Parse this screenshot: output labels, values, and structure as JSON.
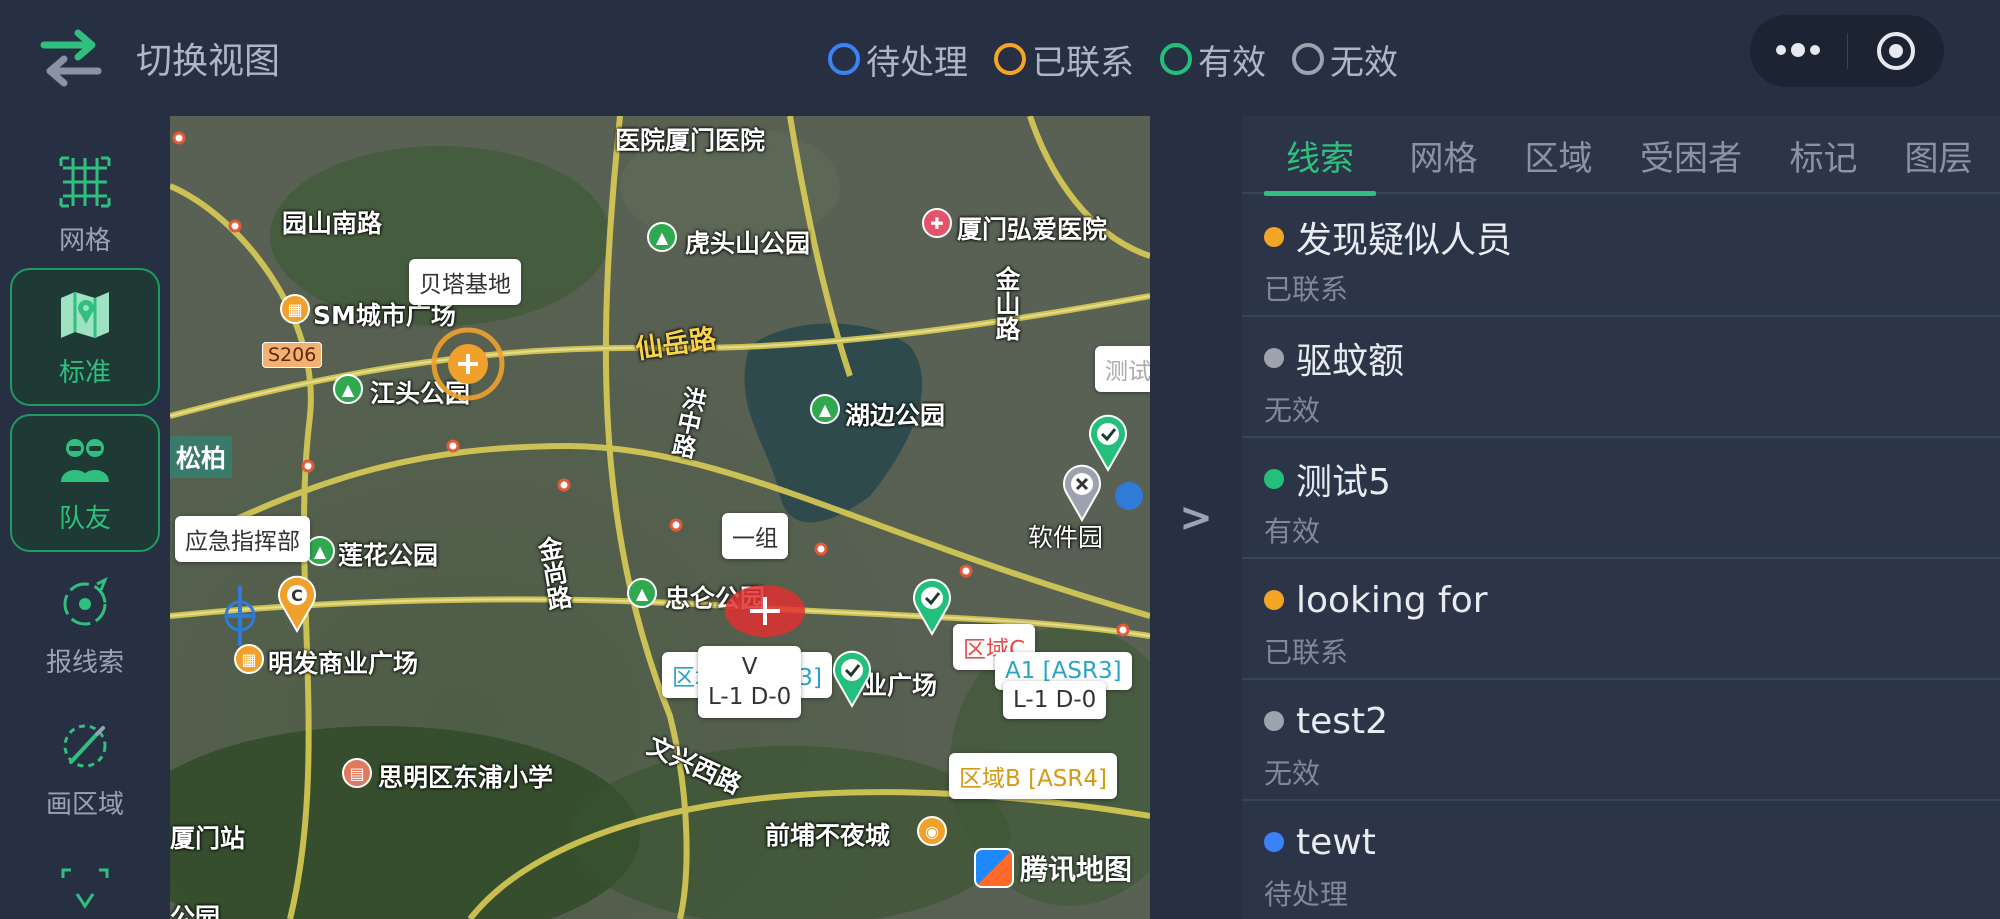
{
  "topbar": {
    "switch_label": "切换视图",
    "legend": [
      {
        "label": "待处理",
        "color": "#3b82f6"
      },
      {
        "label": "已联系",
        "color": "#f5a524"
      },
      {
        "label": "有效",
        "color": "#22c07a"
      },
      {
        "label": "无效",
        "color": "#9ca3af"
      }
    ]
  },
  "toolbar": {
    "items": [
      {
        "label": "网格",
        "icon": "grid-icon"
      },
      {
        "label": "标准",
        "icon": "map-icon"
      },
      {
        "label": "队友",
        "icon": "teammates-icon"
      },
      {
        "label": "报线索",
        "icon": "report-clue-icon"
      },
      {
        "label": "画区域",
        "icon": "draw-area-icon"
      }
    ]
  },
  "map": {
    "labels": {
      "hospital": "医院厦门医院",
      "yuanshan": "园山南路",
      "hutou": "虎头山公园",
      "hongai": "厦门弘爱医院",
      "sm": "SM城市广场",
      "jinshan": "金山路",
      "xianyue": "仙岳路",
      "jiangtou": "江头公园",
      "hubian": "湖边公园",
      "songbai": "松柏",
      "lianhua": "莲花公园",
      "jinshang": "金尚路",
      "zhonglun": "忠仑公园",
      "ruanjian": "软件园",
      "mingfa": "明发商业广场",
      "guangchang": "业广场",
      "dongpu": "思明区东浦小学",
      "wenxing": "文兴西路",
      "xiamen_station": "厦门站",
      "qianpu": "前埔不夜城",
      "bottom_park": "公园",
      "hongzhong": "洪中路"
    },
    "cards": {
      "beita": "贝塔基地",
      "yingji": "应急指挥部",
      "yizu": "一组",
      "v": "V",
      "l1a": "L-1 D-0",
      "l1b": "L-1 D-0",
      "quyu_d": "区域D [ASR3]",
      "quyu_c": "区域C",
      "a1": "A1 [ASR3]",
      "quyu_b": "区域B [ASR4]",
      "ceshi": "测试"
    },
    "badge": "S206",
    "watermark": "腾讯地图"
  },
  "collapse_arrow": ">",
  "panel": {
    "tabs": [
      "线索",
      "网格",
      "区域",
      "受困者",
      "标记",
      "图层"
    ],
    "active_tab": 0,
    "items": [
      {
        "title": "发现疑似人员",
        "status": "已联系",
        "color": "#f5a524"
      },
      {
        "title": "驱蚊额",
        "status": "无效",
        "color": "#9ca3af"
      },
      {
        "title": "测试5",
        "status": "有效",
        "color": "#22c07a"
      },
      {
        "title": "looking for",
        "status": "已联系",
        "color": "#f5a524"
      },
      {
        "title": "test2",
        "status": "无效",
        "color": "#9ca3af"
      },
      {
        "title": "tewt",
        "status": "待处理",
        "color": "#3b82f6"
      }
    ]
  }
}
